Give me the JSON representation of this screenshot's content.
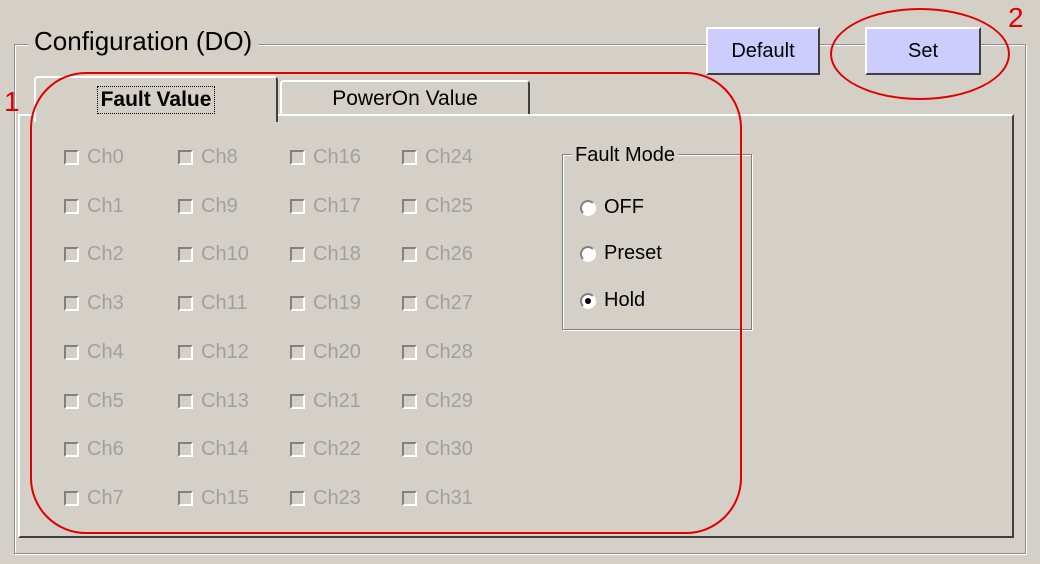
{
  "group": {
    "title": "Configuration  (DO)"
  },
  "buttons": {
    "default_label": "Default",
    "set_label": "Set"
  },
  "tabs": [
    {
      "label": "Fault Value",
      "active": true
    },
    {
      "label": "PowerOn Value",
      "active": false
    }
  ],
  "channels": {
    "col0": [
      "Ch0",
      "Ch1",
      "Ch2",
      "Ch3",
      "Ch4",
      "Ch5",
      "Ch6",
      "Ch7"
    ],
    "col1": [
      "Ch8",
      "Ch9",
      "Ch10",
      "Ch11",
      "Ch12",
      "Ch13",
      "Ch14",
      "Ch15"
    ],
    "col2": [
      "Ch16",
      "Ch17",
      "Ch18",
      "Ch19",
      "Ch20",
      "Ch21",
      "Ch22",
      "Ch23"
    ],
    "col3": [
      "Ch24",
      "Ch25",
      "Ch26",
      "Ch27",
      "Ch28",
      "Ch29",
      "Ch30",
      "Ch31"
    ]
  },
  "fault_mode": {
    "title": "Fault Mode",
    "options": [
      "OFF",
      "Preset",
      "Hold"
    ],
    "selected": "Hold"
  },
  "annotations": {
    "region_number": "1",
    "button_number": "2",
    "color": "#e00000"
  },
  "colors": {
    "panel": "#d4d0c8",
    "button": "#ccccff",
    "disabled_text": "#a0a0a0"
  }
}
